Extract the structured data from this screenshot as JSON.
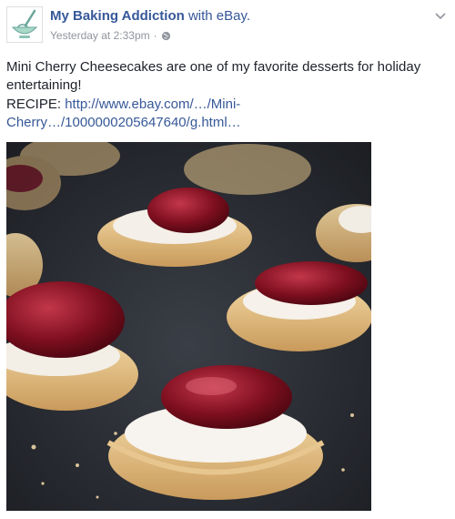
{
  "post": {
    "author": "My Baking Addiction",
    "with_text": "with eBay.",
    "timestamp": "Yesterday at 2:33pm",
    "separator": "·",
    "privacy_icon": "globe-icon",
    "menu_icon": "chevron-down-icon",
    "avatar_icon": "whisk-bowl-logo",
    "text": "Mini Cherry Cheesecakes are one of my favorite desserts for holiday entertaining!",
    "recipe_label": "RECIPE:",
    "recipe_link_line1": "http://www.ebay.com/…/Mini-",
    "recipe_link_line2": "Cherry…/1000000205647640/g.html…",
    "photo_subject": "mini-cherry-cheesecakes-photo"
  },
  "colors": {
    "link": "#365899",
    "text": "#1d2129",
    "meta": "#90949c",
    "avatar_mint": "#a8d8c8"
  }
}
